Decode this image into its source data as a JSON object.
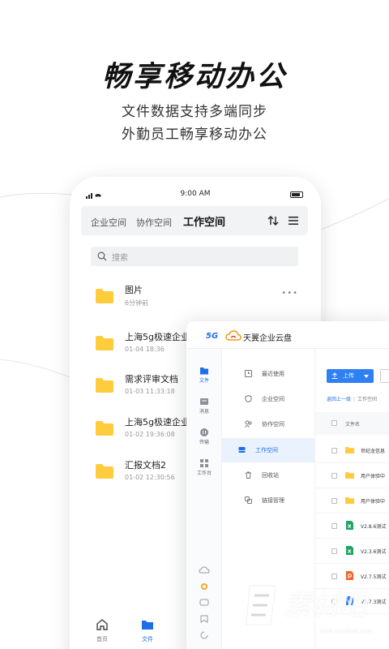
{
  "headline": "畅享移动办公",
  "subtitle1": "文件数据支持多端同步",
  "subtitle2": "外勤员工畅享移动办公",
  "phone": {
    "status_time": "9:00 AM",
    "tabs": [
      {
        "label": "企业空间"
      },
      {
        "label": "协作空间"
      },
      {
        "label": "工作空间"
      }
    ],
    "search_placeholder": "搜索",
    "files": [
      {
        "name": "图片",
        "meta": "6分钟前",
        "icon": "folder-icon"
      },
      {
        "name": "上海5g极速企业",
        "meta": "01-04  18:36",
        "icon": "folder-icon"
      },
      {
        "name": "需求评审文档",
        "meta": "01-03 11:33:18",
        "icon": "folder-icon"
      },
      {
        "name": "上海5g极速企业",
        "meta": "01-02 19:36:08",
        "icon": "folder-icon"
      },
      {
        "name": "汇报文档2",
        "meta": "01-02 12:30:56",
        "icon": "folder-icon"
      }
    ],
    "bottom_nav": [
      {
        "label": "首页",
        "icon": "home-icon"
      },
      {
        "label": "文件",
        "icon": "folder-icon"
      }
    ],
    "accent": "#1b6fe8",
    "folder_color": "#ffcc3d"
  },
  "desktop": {
    "brand_5g": "5G",
    "brand_name": "天翼企业云盘",
    "rail": [
      {
        "label": "文件",
        "icon": "file-icon"
      },
      {
        "label": "消息",
        "icon": "message-icon"
      },
      {
        "label": "传输",
        "icon": "transfer-icon"
      },
      {
        "label": "工作台",
        "icon": "workbench-icon"
      }
    ],
    "nav": [
      {
        "label": "最近使用",
        "icon": "clock-icon"
      },
      {
        "label": "企业空间",
        "icon": "shield-icon"
      },
      {
        "label": "协作空间",
        "icon": "users-icon"
      },
      {
        "label": "工作空间",
        "icon": "drive-icon"
      },
      {
        "label": "回收站",
        "icon": "trash-icon"
      },
      {
        "label": "链接管理",
        "icon": "link-icon"
      }
    ],
    "upload_label": "上传",
    "breadcrumb_back": "返回上一级",
    "breadcrumb_current": "工作空间",
    "column_name": "文件名",
    "files": [
      {
        "name": "世纪龙信息",
        "type": "folder"
      },
      {
        "name": "用户体验中",
        "type": "folder"
      },
      {
        "name": "用户体验中",
        "type": "folder"
      },
      {
        "name": "V2.8.6测试",
        "type": "excel"
      },
      {
        "name": "V2.3.6测试",
        "type": "excel"
      },
      {
        "name": "V2.7.5测试",
        "type": "ppt"
      },
      {
        "name": "V2.7.3测试",
        "type": "word"
      }
    ]
  },
  "watermark": {
    "text": "素材吧",
    "url": "www.sucaibar.com"
  }
}
